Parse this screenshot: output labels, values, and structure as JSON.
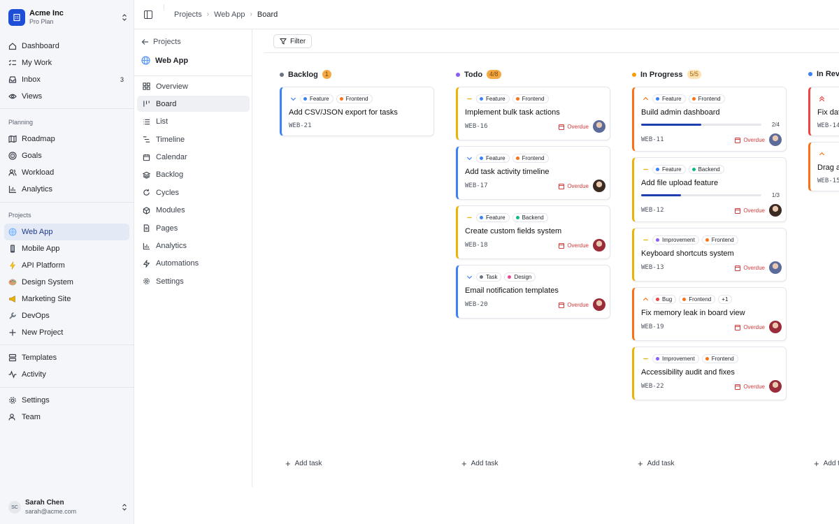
{
  "workspace": {
    "name": "Acme Inc",
    "plan": "Pro Plan"
  },
  "nav": {
    "main": [
      {
        "label": "Dashboard",
        "icon": "home-icon"
      },
      {
        "label": "My Work",
        "icon": "checklist-icon"
      },
      {
        "label": "Inbox",
        "icon": "inbox-icon",
        "badge": "3"
      },
      {
        "label": "Views",
        "icon": "eye-icon"
      }
    ],
    "planning_heading": "Planning",
    "planning": [
      {
        "label": "Roadmap",
        "icon": "map-icon"
      },
      {
        "label": "Goals",
        "icon": "target-icon"
      },
      {
        "label": "Workload",
        "icon": "users-icon"
      },
      {
        "label": "Analytics",
        "icon": "bar-chart-icon"
      }
    ],
    "projects_heading": "Projects",
    "projects": [
      {
        "label": "Web App",
        "icon": "globe-icon",
        "active": true
      },
      {
        "label": "Mobile App",
        "icon": "phone-icon"
      },
      {
        "label": "API Platform",
        "icon": "lightning-icon"
      },
      {
        "label": "Design System",
        "icon": "palette-icon"
      },
      {
        "label": "Marketing Site",
        "icon": "megaphone-icon"
      },
      {
        "label": "DevOps",
        "icon": "wrench-icon"
      },
      {
        "label": "New Project",
        "icon": "plus-icon"
      }
    ],
    "bottom": [
      {
        "label": "Templates",
        "icon": "templates-icon"
      },
      {
        "label": "Activity",
        "icon": "activity-icon"
      }
    ],
    "settings": [
      {
        "label": "Settings",
        "icon": "gear-icon"
      },
      {
        "label": "Team",
        "icon": "team-icon"
      }
    ]
  },
  "user": {
    "initials": "SC",
    "name": "Sarah Chen",
    "email": "sarah@acme.com"
  },
  "breadcrumb": [
    "Projects",
    "Web App",
    "Board"
  ],
  "project_nav": {
    "back_label": "Projects",
    "project_name": "Web App",
    "items": [
      {
        "label": "Overview",
        "icon": "grid-icon"
      },
      {
        "label": "Board",
        "icon": "board-icon",
        "active": true
      },
      {
        "label": "List",
        "icon": "list-icon"
      },
      {
        "label": "Timeline",
        "icon": "timeline-icon"
      },
      {
        "label": "Calendar",
        "icon": "calendar-icon"
      },
      {
        "label": "Backlog",
        "icon": "layers-icon"
      },
      {
        "label": "Cycles",
        "icon": "cycle-icon"
      },
      {
        "label": "Modules",
        "icon": "cube-icon"
      },
      {
        "label": "Pages",
        "icon": "page-icon"
      },
      {
        "label": "Analytics",
        "icon": "bar-chart-icon"
      },
      {
        "label": "Automations",
        "icon": "zap-icon"
      },
      {
        "label": "Settings",
        "icon": "gear-icon"
      }
    ]
  },
  "filter_label": "Filter",
  "add_task_label": "Add task",
  "overdue_label": "Overdue",
  "colors": {
    "accent": "#1d4ed8",
    "feature": "#3b82f6",
    "frontend": "#f97316",
    "backend": "#10b981",
    "task": "#6b7280",
    "design": "#ec4899",
    "improvement": "#8b5cf6",
    "bug": "#ef4444",
    "overdue": "#d43c3c"
  },
  "columns": [
    {
      "name": "Backlog",
      "count": "1",
      "dot": "#6b7280",
      "count_bg": "#f5a944",
      "count_fg": "#7a4a05",
      "cards": [
        {
          "priority": "low",
          "border": "#3b82f6",
          "tags": [
            {
              "label": "Feature",
              "color": "#3b82f6"
            },
            {
              "label": "Frontend",
              "color": "#f97316"
            }
          ],
          "title": "Add CSV/JSON export for tasks",
          "id": "WEB-21"
        }
      ]
    },
    {
      "name": "Todo",
      "count": "4/8",
      "dot": "#8b5cf6",
      "count_bg": "#f5a944",
      "count_fg": "#7a4a05",
      "cards": [
        {
          "priority": "medium",
          "border": "#eab308",
          "tags": [
            {
              "label": "Feature",
              "color": "#3b82f6"
            },
            {
              "label": "Frontend",
              "color": "#f97316"
            }
          ],
          "title": "Implement bulk task actions",
          "id": "WEB-16",
          "overdue": true,
          "avatar": "#5b6b9a"
        },
        {
          "priority": "low",
          "border": "#3b82f6",
          "tags": [
            {
              "label": "Feature",
              "color": "#3b82f6"
            },
            {
              "label": "Frontend",
              "color": "#f97316"
            }
          ],
          "title": "Add task activity timeline",
          "id": "WEB-17",
          "overdue": true,
          "avatar": "#3a2a22"
        },
        {
          "priority": "medium",
          "border": "#eab308",
          "tags": [
            {
              "label": "Feature",
              "color": "#3b82f6"
            },
            {
              "label": "Backend",
              "color": "#10b981"
            }
          ],
          "title": "Create custom fields system",
          "id": "WEB-18",
          "overdue": true,
          "avatar": "#9b2c3a"
        },
        {
          "priority": "low",
          "border": "#3b82f6",
          "tags": [
            {
              "label": "Task",
              "color": "#6b7280"
            },
            {
              "label": "Design",
              "color": "#ec4899"
            }
          ],
          "title": "Email notification templates",
          "id": "WEB-20",
          "overdue": true,
          "avatar": "#9b2c3a"
        }
      ]
    },
    {
      "name": "In Progress",
      "count": "5/5",
      "dot": "#f59e0b",
      "count_bg": "#fde2b3",
      "count_fg": "#a16207",
      "cards": [
        {
          "priority": "high",
          "border": "#f97316",
          "tags": [
            {
              "label": "Feature",
              "color": "#3b82f6"
            },
            {
              "label": "Frontend",
              "color": "#f97316"
            }
          ],
          "title": "Build admin dashboard",
          "id": "WEB-11",
          "overdue": true,
          "avatar": "#5b6b9a",
          "progress": 0.5,
          "progress_label": "2/4"
        },
        {
          "priority": "medium",
          "border": "#eab308",
          "tags": [
            {
              "label": "Feature",
              "color": "#3b82f6"
            },
            {
              "label": "Backend",
              "color": "#10b981"
            }
          ],
          "title": "Add file upload feature",
          "id": "WEB-12",
          "overdue": true,
          "avatar": "#3a2a22",
          "progress": 0.333,
          "progress_label": "1/3"
        },
        {
          "priority": "medium",
          "border": "#eab308",
          "tags": [
            {
              "label": "Improvement",
              "color": "#8b5cf6"
            },
            {
              "label": "Frontend",
              "color": "#f97316"
            }
          ],
          "title": "Keyboard shortcuts system",
          "id": "WEB-13",
          "overdue": true,
          "avatar": "#5b6b9a"
        },
        {
          "priority": "high",
          "border": "#f97316",
          "tags": [
            {
              "label": "Bug",
              "color": "#ef4444"
            },
            {
              "label": "Frontend",
              "color": "#f97316"
            },
            {
              "label": "+1",
              "color": ""
            }
          ],
          "title": "Fix memory leak in board view",
          "id": "WEB-19",
          "overdue": true,
          "avatar": "#9b2c3a"
        },
        {
          "priority": "medium",
          "border": "#eab308",
          "tags": [
            {
              "label": "Improvement",
              "color": "#8b5cf6"
            },
            {
              "label": "Frontend",
              "color": "#f97316"
            }
          ],
          "title": "Accessibility audit and fixes",
          "id": "WEB-22",
          "overdue": true,
          "avatar": "#9b2c3a"
        }
      ]
    },
    {
      "name": "In Rev",
      "count": "",
      "dot": "#3b82f6",
      "count_bg": "",
      "count_fg": "",
      "cards": [
        {
          "priority": "urgent",
          "border": "#ef4444",
          "tags": [],
          "title": "Fix dat",
          "id": "WEB-14"
        },
        {
          "priority": "high",
          "border": "#f97316",
          "tags": [],
          "title": "Drag a",
          "id": "WEB-15"
        }
      ]
    }
  ]
}
